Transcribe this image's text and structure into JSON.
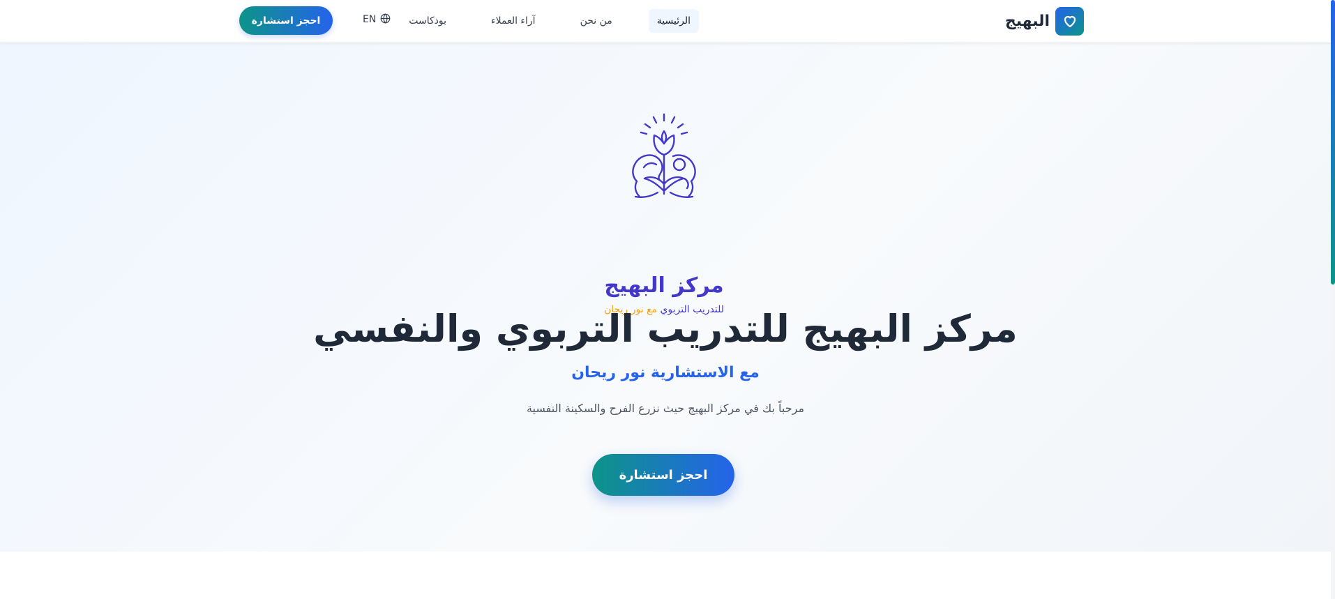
{
  "header": {
    "brand_name": "البهيج",
    "brand_icon": "heart-icon",
    "nav": [
      {
        "label": "الرئيسية",
        "active": true
      },
      {
        "label": "من نحن",
        "active": false
      },
      {
        "label": "آراء العملاء",
        "active": false
      },
      {
        "label": "بودكاست",
        "active": false
      }
    ],
    "language_label": "EN",
    "language_icon": "globe-icon",
    "cta_label": "احجز استشارة"
  },
  "logo": {
    "title": "مركز البهيج",
    "subtitle_main": "للتدريب التربوي",
    "subtitle_accent": "مع نور ريحان",
    "primary_color": "#4338ca",
    "accent_color": "#f59e0b"
  },
  "hero": {
    "title": "مركز البهيج للتدريب التربوي والنفسي",
    "subtitle": "مع الاستشارية نور ريحان",
    "welcome_text": "مرحباً بك في مركز البهيج حيث نزرع الفرح والسكينة النفسية",
    "cta_label": "احجز استشارة"
  },
  "colors": {
    "brand_blue": "#2563eb",
    "brand_teal": "#0d9488",
    "heading": "#1f2937"
  }
}
